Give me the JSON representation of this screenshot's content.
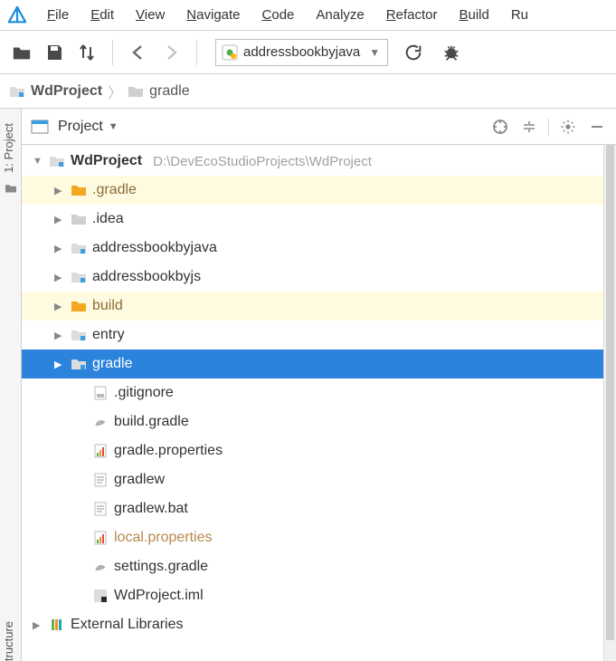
{
  "menu": {
    "items": [
      "File",
      "Edit",
      "View",
      "Navigate",
      "Code",
      "Analyze",
      "Refactor",
      "Build",
      "Ru"
    ],
    "underline_first": [
      true,
      true,
      true,
      true,
      true,
      false,
      true,
      true,
      false
    ]
  },
  "toolbar": {
    "run_config": "addressbookbyjava"
  },
  "breadcrumb": {
    "project": "WdProject",
    "folder": "gradle"
  },
  "panel": {
    "title": "Project"
  },
  "gutter": {
    "top": "1: Project",
    "bottom": "tructure"
  },
  "tree": {
    "root": {
      "name": "WdProject",
      "path": "D:\\DevEcoStudioProjects\\WdProject"
    },
    "children": [
      {
        "name": ".gradle",
        "type": "folder-orange",
        "highlighted": true,
        "expandable": true
      },
      {
        "name": ".idea",
        "type": "folder",
        "highlighted": false,
        "expandable": true
      },
      {
        "name": "addressbookbyjava",
        "type": "module",
        "highlighted": false,
        "expandable": true
      },
      {
        "name": "addressbookbyjs",
        "type": "module",
        "highlighted": false,
        "expandable": true
      },
      {
        "name": "build",
        "type": "folder-orange",
        "highlighted": true,
        "expandable": true
      },
      {
        "name": "entry",
        "type": "module",
        "highlighted": false,
        "expandable": true
      },
      {
        "name": "gradle",
        "type": "module",
        "selected": true,
        "expandable": true
      }
    ],
    "files": [
      {
        "name": ".gitignore",
        "type": "file"
      },
      {
        "name": "build.gradle",
        "type": "gradle"
      },
      {
        "name": "gradle.properties",
        "type": "props"
      },
      {
        "name": "gradlew",
        "type": "text"
      },
      {
        "name": "gradlew.bat",
        "type": "text"
      },
      {
        "name": "local.properties",
        "type": "props",
        "muted": true
      },
      {
        "name": "settings.gradle",
        "type": "gradle"
      },
      {
        "name": "WdProject.iml",
        "type": "iml"
      }
    ],
    "footer": "External Libraries"
  }
}
